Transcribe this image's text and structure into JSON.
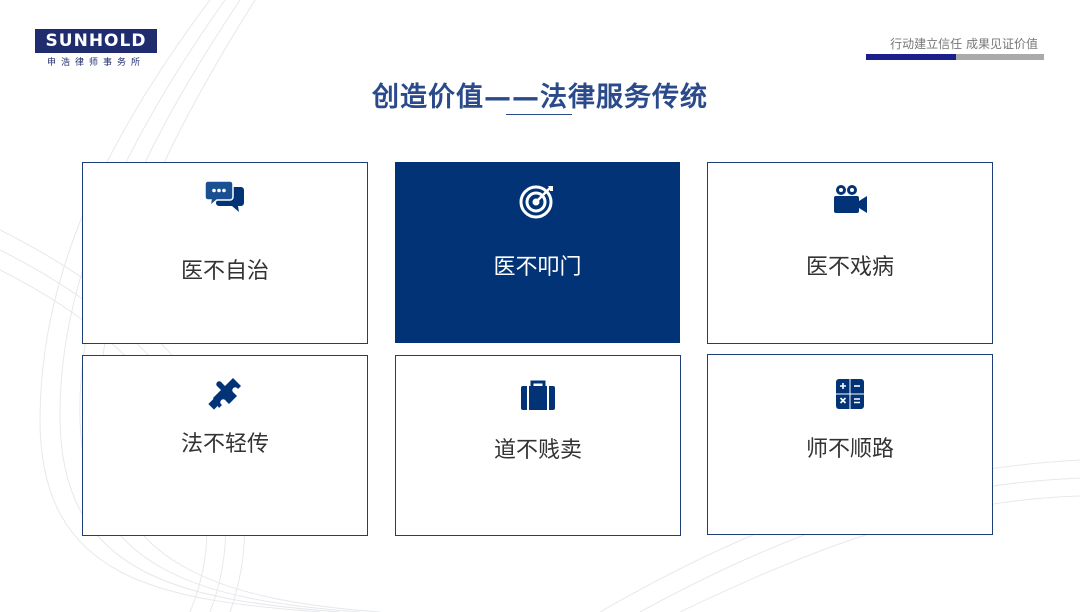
{
  "logo": {
    "name": "SUNHOLD",
    "subtitle": "申浩律师事务所"
  },
  "slogan": "行动建立信任 成果见证价值",
  "title": "创造价值——法律服务传统",
  "colors": {
    "primary": "#033377",
    "title": "#2a4a8c",
    "bar_accent": "#1a1f8c",
    "bar_base": "#aaaaaa"
  },
  "cards": [
    {
      "label": "医不自治",
      "icon": "chat-bubbles-icon",
      "active": false
    },
    {
      "label": "医不叩门",
      "icon": "target-icon",
      "active": true
    },
    {
      "label": "医不戏病",
      "icon": "video-camera-icon",
      "active": false
    },
    {
      "label": "法不轻传",
      "icon": "puzzle-piece-icon",
      "active": false
    },
    {
      "label": "道不贱卖",
      "icon": "briefcase-icon",
      "active": false
    },
    {
      "label": "师不顺路",
      "icon": "calculator-icon",
      "active": false
    }
  ]
}
